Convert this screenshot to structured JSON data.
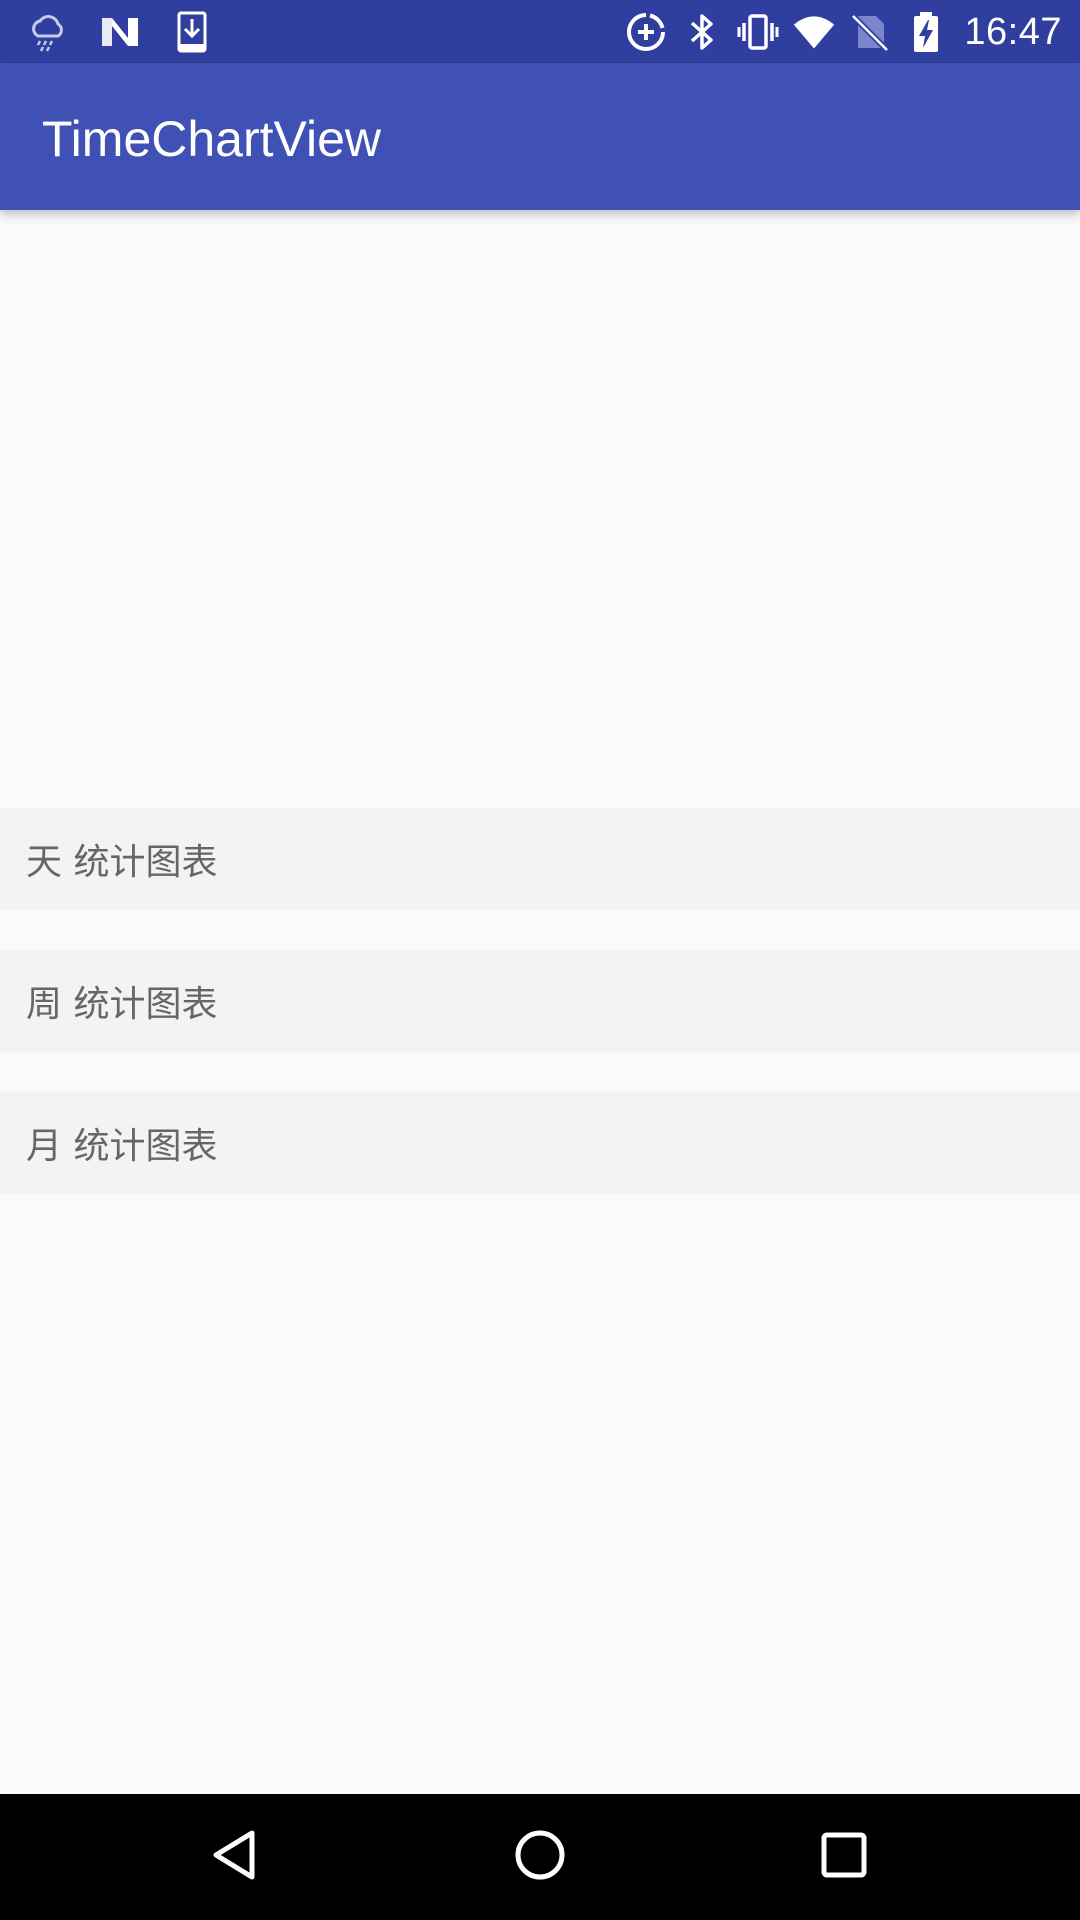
{
  "status_bar": {
    "time": "16:47",
    "left_icons": [
      "cloud-rain-icon",
      "n-logo-icon",
      "download-icon"
    ],
    "right_icons": [
      "data-saver-icon",
      "bluetooth-icon",
      "vibrate-icon",
      "wifi-icon",
      "no-sim-icon",
      "battery-charging-icon"
    ],
    "background_color": "#303F9F"
  },
  "app_bar": {
    "title": "TimeChartView",
    "background_color": "#3F51B5"
  },
  "menu": {
    "items": [
      {
        "label": "天 统计图表"
      },
      {
        "label": "周 统计图表"
      },
      {
        "label": "月 统计图表"
      }
    ]
  },
  "nav_bar": {
    "buttons": [
      "back-icon",
      "home-icon",
      "recents-icon"
    ]
  }
}
